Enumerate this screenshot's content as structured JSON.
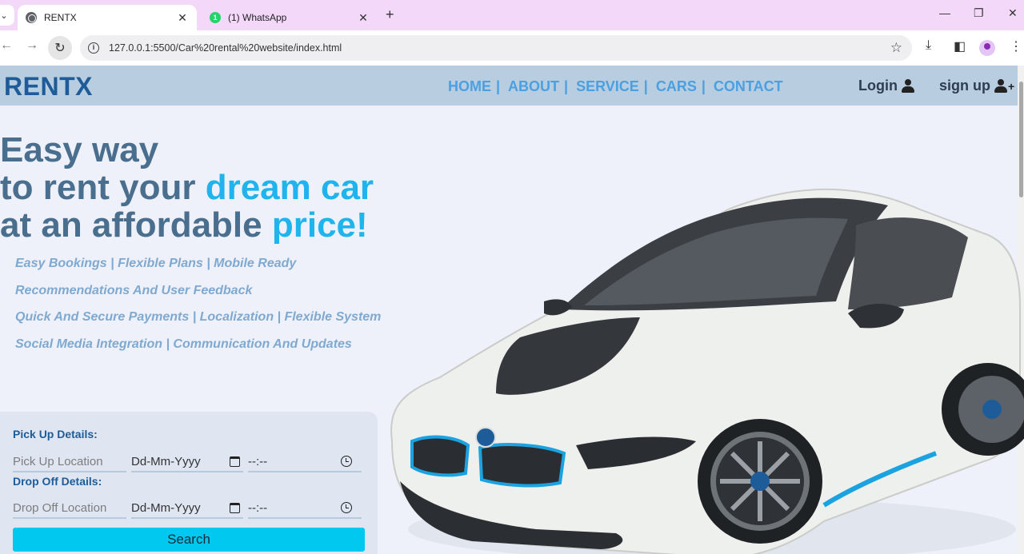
{
  "browser": {
    "tabs": [
      {
        "title": "RENTX",
        "icon": "globe-icon",
        "active": true
      },
      {
        "title": "(1) WhatsApp",
        "icon": "whatsapp-icon",
        "badge": "1",
        "active": false
      }
    ],
    "url": "127.0.0.1:5500/Car%20rental%20website/index.html"
  },
  "site": {
    "brand": "RENTX",
    "nav": [
      "HOME",
      "ABOUT",
      "SERVICE",
      "CARS",
      "CONTACT"
    ],
    "nav_separator": "|",
    "login_label": "Login",
    "signup_label": "sign up",
    "signup_plus": "+"
  },
  "hero": {
    "line1": "Easy way",
    "line2_prefix": "to rent your ",
    "line2_accent": "dream car",
    "line3_prefix": "at an affordable ",
    "line3_accent": "price!"
  },
  "features": [
    "Easy Bookings | Flexible Plans | Mobile Ready",
    "Recommendations And User Feedback",
    "Quick And Secure Payments | Localization | Flexible System",
    "Social Media Integration | Communication And Updates"
  ],
  "booking": {
    "pickup_heading": "Pick Up Details:",
    "pickup_location_placeholder": "Pick Up Location",
    "dropoff_heading": "Drop Off Details:",
    "dropoff_location_placeholder": "Drop Off Location",
    "date_placeholder": "Dd-Mm-Yyyy",
    "time_placeholder": "--:--",
    "search_label": "Search"
  },
  "colors": {
    "brand": "#1d5c99",
    "nav_link": "#4aa0e0",
    "accent": "#1fb4ee",
    "search_button": "#00c8ee",
    "navbar_bg": "#b9cde0"
  }
}
